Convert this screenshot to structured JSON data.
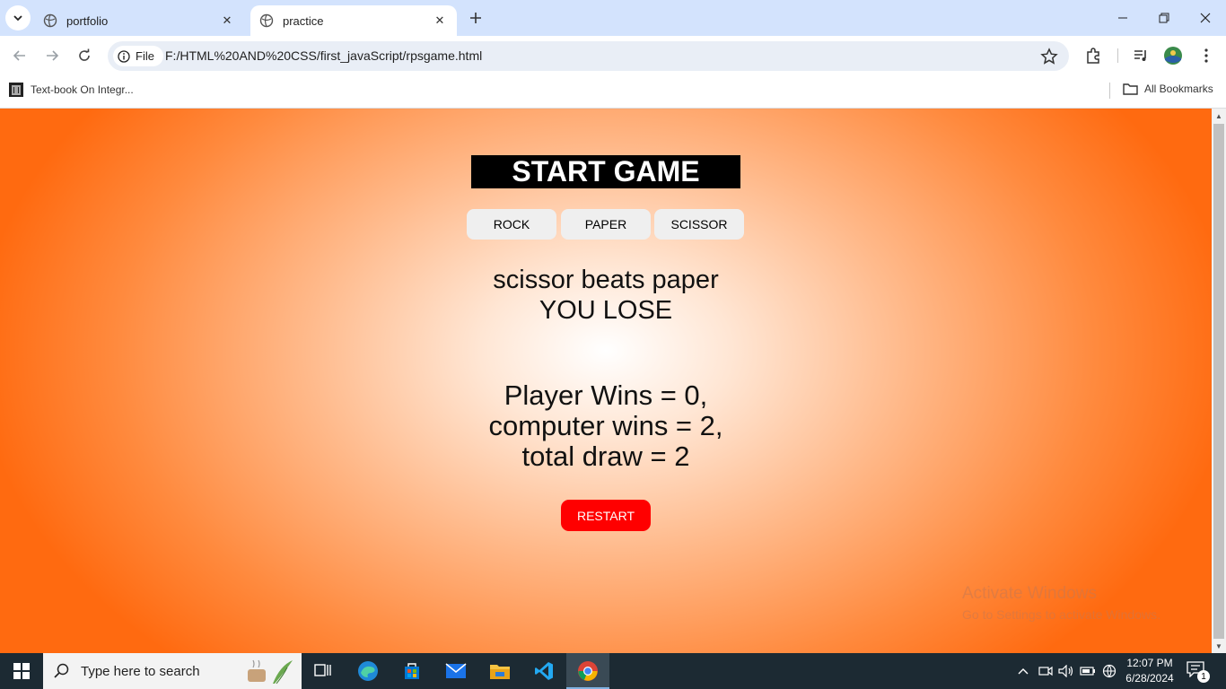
{
  "browser": {
    "tabs": [
      {
        "title": "portfolio",
        "active": false
      },
      {
        "title": "practice",
        "active": true
      }
    ],
    "omnibox": {
      "site_chip": "File",
      "url": "F:/HTML%20AND%20CSS/first_javaScript/rpsgame.html"
    },
    "bookmarks": {
      "items": [
        {
          "label": "Text-book On Integr..."
        }
      ],
      "all_label": "All Bookmarks"
    }
  },
  "game": {
    "title": "START GAME",
    "choices": [
      "ROCK",
      "PAPER",
      "SCISSOR"
    ],
    "result_message": "scissor beats paper",
    "result_status": "YOU LOSE",
    "score": {
      "player_line": "Player Wins = 0,",
      "computer_line": "computer wins = 2,",
      "draw_line": "total draw = 2"
    },
    "restart_label": "RESTART"
  },
  "watermark": {
    "title": "Activate Windows",
    "subtitle": "Go to Settings to activate Windows."
  },
  "taskbar": {
    "search_placeholder": "Type here to search",
    "clock_time": "12:07 PM",
    "clock_date": "6/28/2024",
    "notification_count": "1"
  },
  "colors": {
    "restart_bg": "#ff0000",
    "title_bg": "#000000",
    "gradient_edge": "#ff6a10",
    "gradient_center": "#ffffff"
  }
}
